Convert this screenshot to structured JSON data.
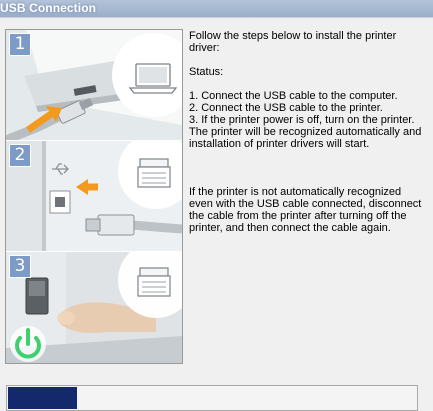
{
  "window": {
    "title": "USB Connection"
  },
  "steps": [
    {
      "number": "1"
    },
    {
      "number": "2"
    },
    {
      "number": "3"
    }
  ],
  "instructions": {
    "intro": "Follow the steps below to install the printer driver:",
    "status_label": "Status:",
    "step1": "1. Connect the USB cable to the computer.",
    "step2": "2. Connect the USB cable to the printer.",
    "step3": "3. If the printer power is off, turn on the printer.",
    "auto_note": "The printer will be recognized automatically and installation of printer drivers will start.",
    "retry_note": "If the printer is not automatically recognized even with the USB cable connected, disconnect the cable from the printer after turning off the printer, and then connect the cable again."
  },
  "progress": {
    "fraction": 0.17,
    "bar_color": "#13296b"
  },
  "icons": [
    "laptop-icon",
    "printer-icon",
    "usb-icon",
    "power-icon",
    "arrow-icon"
  ]
}
